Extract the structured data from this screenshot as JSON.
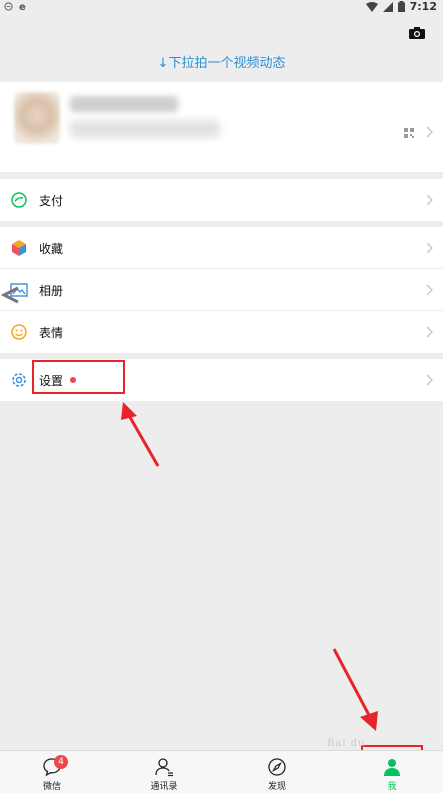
{
  "status_bar": {
    "time": "7:12"
  },
  "header": {
    "pull_hint": "↓下拉拍一个视频动态"
  },
  "menu": {
    "pay": "支付",
    "favorites": "收藏",
    "album": "相册",
    "stickers": "表情",
    "settings": "设置"
  },
  "tabs": [
    {
      "label": "微信",
      "badge": "4"
    },
    {
      "label": "通讯录"
    },
    {
      "label": "发现"
    },
    {
      "label": "我"
    }
  ],
  "colors": {
    "accent_green": "#07c160",
    "hint_blue": "#2a90d6",
    "badge_red": "#f04848",
    "annotation_red": "#e8242a"
  }
}
